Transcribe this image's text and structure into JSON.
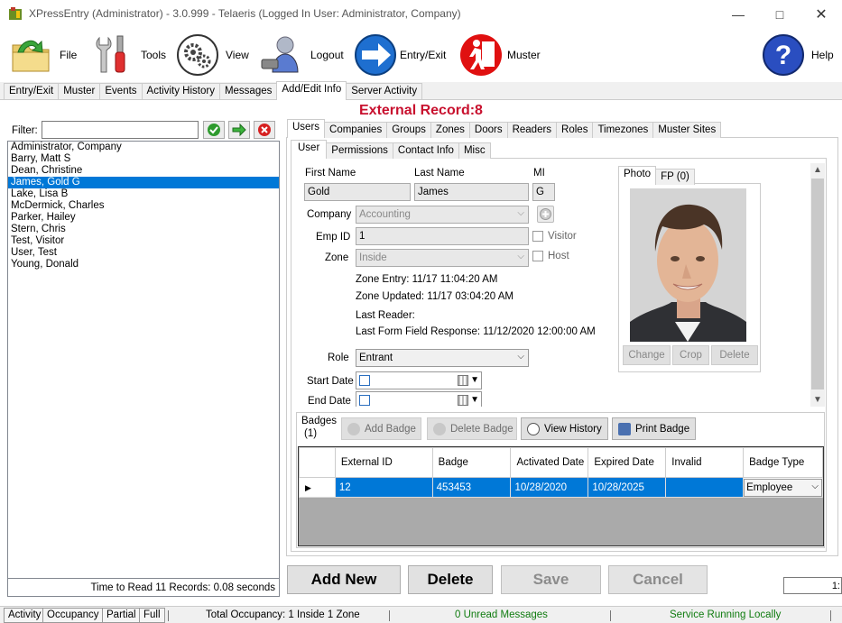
{
  "window": {
    "title": "XPressEntry (Administrator)  - 3.0.999 - Telaeris (Logged In User: Administrator, Company)"
  },
  "toolbar": {
    "file": "File",
    "tools": "Tools",
    "view": "View",
    "logout": "Logout",
    "entry_exit": "Entry/Exit",
    "muster": "Muster",
    "help": "Help"
  },
  "main_tabs": [
    "Entry/Exit",
    "Muster",
    "Events",
    "Activity History",
    "Messages",
    "Add/Edit Info",
    "Server Activity"
  ],
  "header": {
    "external_record": "External Record:8"
  },
  "filter": {
    "label": "Filter:",
    "value": ""
  },
  "users": [
    "Administrator, Company",
    "Barry, Matt S",
    "Dean, Christine",
    "James, Gold G",
    "Lake, Lisa B",
    "McDermick, Charles",
    "Parker, Hailey",
    "Stern, Chris",
    "Test, Visitor",
    "User, Test",
    "Young, Donald"
  ],
  "read_time": "Time to Read 11 Records: 0.08 seconds",
  "entity_tabs": [
    "Users",
    "Companies",
    "Groups",
    "Zones",
    "Doors",
    "Readers",
    "Roles",
    "Timezones",
    "Muster Sites"
  ],
  "user_tabs": [
    "User",
    "Permissions",
    "Contact Info",
    "Misc"
  ],
  "form": {
    "first_name_label": "First Name",
    "last_name_label": "Last Name",
    "mi_label": "MI",
    "first_name": "Gold",
    "last_name": "James",
    "mi": "G",
    "company_label": "Company",
    "company": "Accounting",
    "emp_id_label": "Emp ID",
    "emp_id": "1",
    "visitor_label": "Visitor",
    "zone_label": "Zone",
    "zone": "Inside",
    "host_label": "Host",
    "zone_entry": "Zone Entry: 11/17 11:04:20 AM",
    "zone_updated": "Zone Updated: 11/17 03:04:20 AM",
    "last_reader": "Last Reader:",
    "last_form_field": "Last Form Field Response: 11/12/2020 12:00:00 AM",
    "role_label": "Role",
    "role": "Entrant",
    "start_date_label": "Start Date",
    "end_date_label": "End Date"
  },
  "photo": {
    "tabs": [
      "Photo",
      "FP (0)"
    ],
    "change": "Change",
    "crop": "Crop",
    "delete": "Delete"
  },
  "badges": {
    "title": "Badges",
    "count": "(1)",
    "add": "Add Badge",
    "delete": "Delete Badge",
    "history": "View History",
    "print": "Print Badge",
    "headers": [
      "External ID",
      "Badge",
      "Activated Date",
      "Expired Date",
      "Invalid",
      "Badge Type"
    ],
    "rows": [
      {
        "external_id": "12",
        "badge": "453453",
        "activated": "10/28/2020",
        "expired": "10/28/2025",
        "invalid": "",
        "type": "Employee"
      }
    ]
  },
  "actions": {
    "add_new": "Add New",
    "delete": "Delete",
    "save": "Save",
    "cancel": "Cancel"
  },
  "page_box": "1:",
  "status": {
    "tabs": [
      "Activity",
      "Occupancy",
      "Partial",
      "Full"
    ],
    "occupancy": "Total Occupancy: 1 Inside 1 Zone",
    "messages": "0 Unread Messages",
    "service": "Service Running Locally"
  },
  "colors": {
    "accent": "#0078d7",
    "record_red": "#c8102e",
    "messages_green": "#107c10"
  }
}
